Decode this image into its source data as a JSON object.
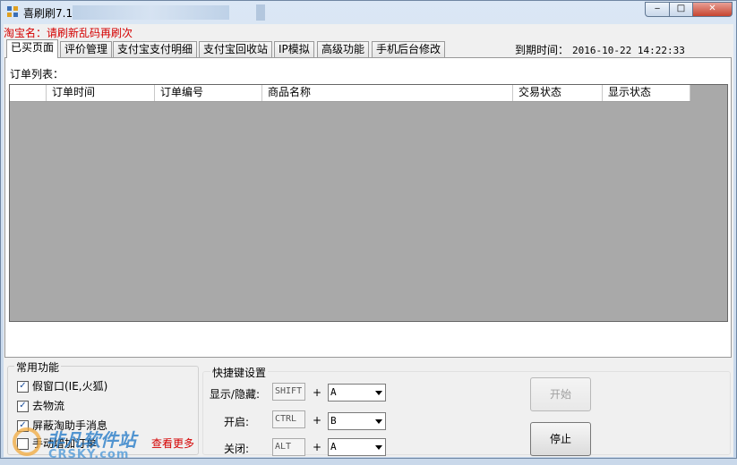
{
  "window": {
    "title": "喜刷刷7.1",
    "controls": {
      "minimize": "‒",
      "maximize": "□",
      "close": "✕"
    }
  },
  "shop_label": "淘宝名：请刷新乱码再刷次",
  "tabs": [
    {
      "label": "已买页面",
      "active": true
    },
    {
      "label": "评价管理"
    },
    {
      "label": "支付宝支付明细"
    },
    {
      "label": "支付宝回收站"
    },
    {
      "label": "IP模拟"
    },
    {
      "label": "高级功能"
    },
    {
      "label": "手机后台修改"
    }
  ],
  "expire": {
    "label": "到期时间：",
    "value": "2016-10-22 14:22:33"
  },
  "orders": {
    "label": "订单列表：",
    "columns": [
      "",
      "订单时间",
      "订单编号",
      "商品名称",
      "交易状态",
      "显示状态"
    ],
    "rows": []
  },
  "common": {
    "title": "常用功能",
    "checkboxes": [
      {
        "label": "假窗口(IE,火狐)",
        "checked": true
      },
      {
        "label": "去物流",
        "checked": true
      },
      {
        "label": "屏蔽淘助手消息",
        "checked": true
      },
      {
        "label": "手动增加订单",
        "checked": false
      }
    ],
    "more_link": "查看更多"
  },
  "hotkeys": {
    "title": "快捷键设置",
    "rows": [
      {
        "label": "显示/隐藏:",
        "modifier": "SHIFT",
        "plus": "+",
        "key": "A"
      },
      {
        "label": "开启:",
        "modifier": "CTRL",
        "plus": "+",
        "key": "B"
      },
      {
        "label": "关闭:",
        "modifier": "ALT",
        "plus": "+",
        "key": "A"
      }
    ]
  },
  "buttons": {
    "start": "开始",
    "stop": "停止"
  },
  "watermark": {
    "text": "非凡软件站",
    "sub": "CRSKY.com"
  },
  "colors": {
    "alert_red": "#d40000",
    "grid_gray": "#a9a9a9"
  }
}
